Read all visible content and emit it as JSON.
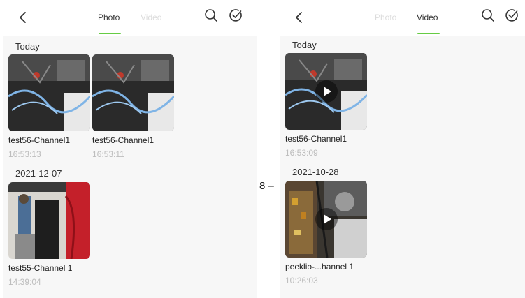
{
  "annotation": "8 –",
  "photo_screen": {
    "tabs": [
      {
        "label": "Photo",
        "active": true
      },
      {
        "label": "Video",
        "active": false
      }
    ],
    "sections": [
      {
        "date": "Today",
        "items": [
          {
            "name": "test56-Channel1",
            "time": "16:53:13"
          },
          {
            "name": "test56-Channel1",
            "time": "16:53:11"
          }
        ]
      },
      {
        "date": "2021-12-07",
        "items": [
          {
            "name": "test55-Channel 1",
            "time": "14:39:04"
          }
        ]
      }
    ]
  },
  "video_screen": {
    "tabs": [
      {
        "label": "Photo",
        "active": false
      },
      {
        "label": "Video",
        "active": true
      }
    ],
    "sections": [
      {
        "date": "Today",
        "items": [
          {
            "name": "test56-Channel1",
            "time": "16:53:09"
          }
        ]
      },
      {
        "date": "2021-10-28",
        "items": [
          {
            "name": "peeklio-...hannel 1",
            "time": "10:26:03"
          }
        ]
      }
    ]
  },
  "colors": {
    "accent": "#66cc44",
    "background": "#f7f7f7",
    "inactive_tab": "#dcdcdc",
    "timestamp": "#bdbdbd"
  },
  "icons": [
    "chevron-left-icon",
    "search-icon",
    "check-circle-icon",
    "play-icon"
  ]
}
